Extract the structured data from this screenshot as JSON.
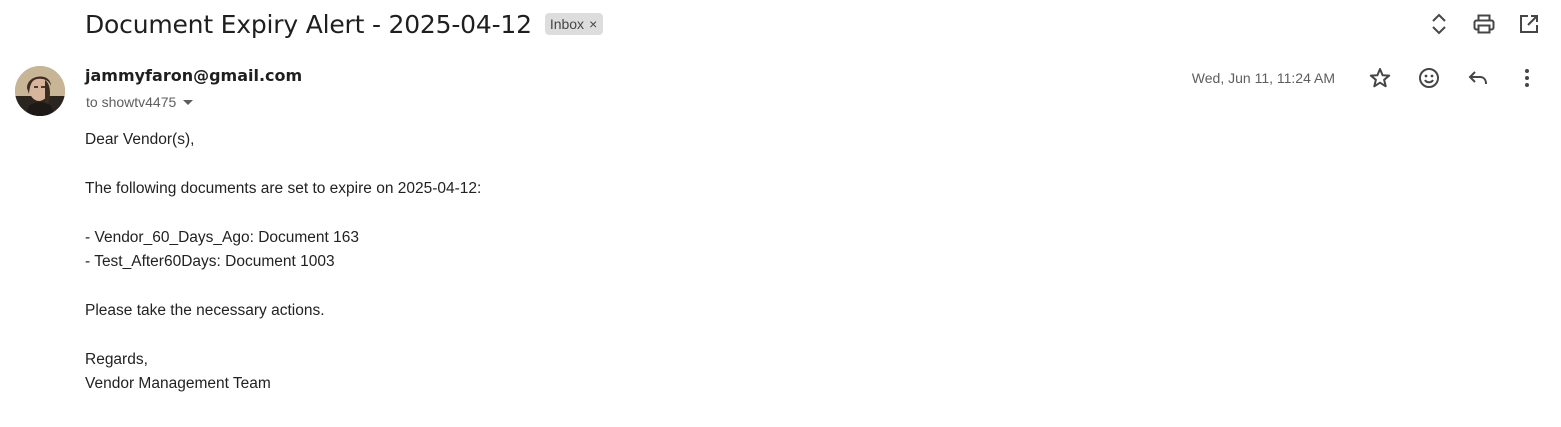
{
  "email": {
    "subject": "Document Expiry Alert - 2025-04-12",
    "label": "Inbox",
    "label_remove": "×",
    "sender": "jammyfaron@gmail.com",
    "recipient": "to showtv4475",
    "timestamp": "Wed, Jun 11, 11:24 AM",
    "body_lines": [
      "Dear Vendor(s),",
      "",
      "The following documents are set to expire on 2025-04-12:",
      "",
      "- Vendor_60_Days_Ago: Document 163",
      "- Test_After60Days: Document 1003",
      "",
      "Please take the necessary actions.",
      "",
      "Regards,",
      "Vendor Management Team"
    ]
  },
  "icons": {
    "top_actions": [
      "expand-collapse-icon",
      "print-icon",
      "open-in-new-window-icon"
    ],
    "meta_actions": [
      "star-icon",
      "emoji-reaction-icon",
      "reply-icon",
      "more-options-icon"
    ]
  }
}
